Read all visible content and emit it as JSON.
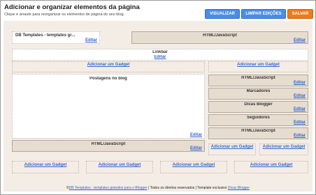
{
  "header": {
    "title": "Adicionar e organizar elementos da página",
    "subtitle": "Clique e arraste para reorganizar os elementos de página do seu blog.",
    "buttons": {
      "view": "VISUALIZAR",
      "clear": "LIMPAR EDIÇÕES",
      "save": "SALVAR"
    }
  },
  "colors": {
    "blue_button": "#4a8de8",
    "orange_button": "#f07a1a",
    "canvas": "#f4ede6",
    "widget": "#e6ddd0",
    "link": "#3366cc"
  },
  "edit_label": "Editar",
  "add_gadget_label": "Adicionar um Gadget",
  "header_area": {
    "left_widget": "DB Templates - templates gr...",
    "right_widget": "HTML/JavaScript"
  },
  "linkbar": {
    "title": "Linkbar"
  },
  "main": {
    "title": "Postagens no blog",
    "bottom_widget": "HTML/JavaScript"
  },
  "sidebar": {
    "widgets": [
      "HTML/JavaScript",
      "Marcadores",
      "Dicas Blogger",
      "Seguidores",
      "HTML/JavaScript"
    ]
  },
  "footer": {
    "prefix": "©",
    "link1": "DB Templates - templates gratuitos para o Blogger",
    "middle": " | Todos os direitos reservados | Template exclusivo ",
    "link2": "Dicas Blogger"
  }
}
